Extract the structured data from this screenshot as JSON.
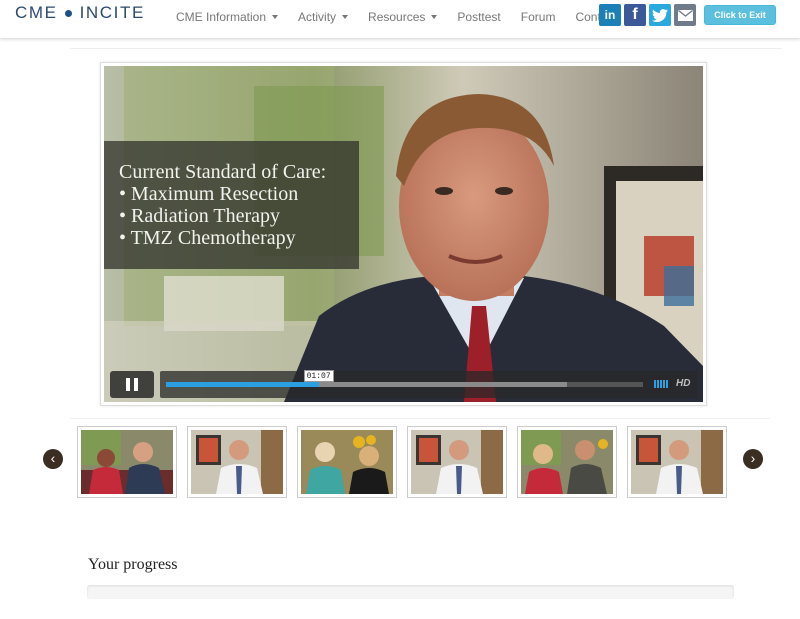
{
  "brand": {
    "left": "CME",
    "right": "INCITE",
    "accent": "#1f4f8a"
  },
  "nav": {
    "items": [
      {
        "label": "CME Information",
        "dropdown": true
      },
      {
        "label": "Activity",
        "dropdown": true
      },
      {
        "label": "Resources",
        "dropdown": true
      },
      {
        "label": "Posttest",
        "dropdown": false
      },
      {
        "label": "Forum",
        "dropdown": false
      },
      {
        "label": "Contact",
        "dropdown": false
      }
    ],
    "social": [
      {
        "icon": "linkedin-icon",
        "text": "in",
        "color": "#1a80b6"
      },
      {
        "icon": "facebook-icon",
        "text": "f",
        "color": "#3b5998"
      },
      {
        "icon": "twitter-icon",
        "text": "",
        "color": "#2aa9e0"
      },
      {
        "icon": "email-icon",
        "text": "",
        "color": "#6f7b8a"
      }
    ],
    "exit_label": "Click to Exit"
  },
  "video": {
    "slide_lines": [
      "Current Standard of Care:",
      "• Maximum Resection",
      "• Radiation Therapy",
      "• TMZ Chemotherapy"
    ],
    "current_time": "01:07",
    "played_fraction": 0.32,
    "loaded_fraction": 0.84,
    "hd_label": "HD",
    "state": "playing"
  },
  "thumbnails": [
    {
      "subject": "two people on couch"
    },
    {
      "subject": "doctor in white coat"
    },
    {
      "subject": "two women on couch"
    },
    {
      "subject": "doctor in white coat"
    },
    {
      "subject": "man and woman on couch"
    },
    {
      "subject": "doctor in white coat"
    }
  ],
  "carousel": {
    "prev_glyph": "‹",
    "next_glyph": "›"
  },
  "progress": {
    "title": "Your progress",
    "fraction": 0.0
  }
}
